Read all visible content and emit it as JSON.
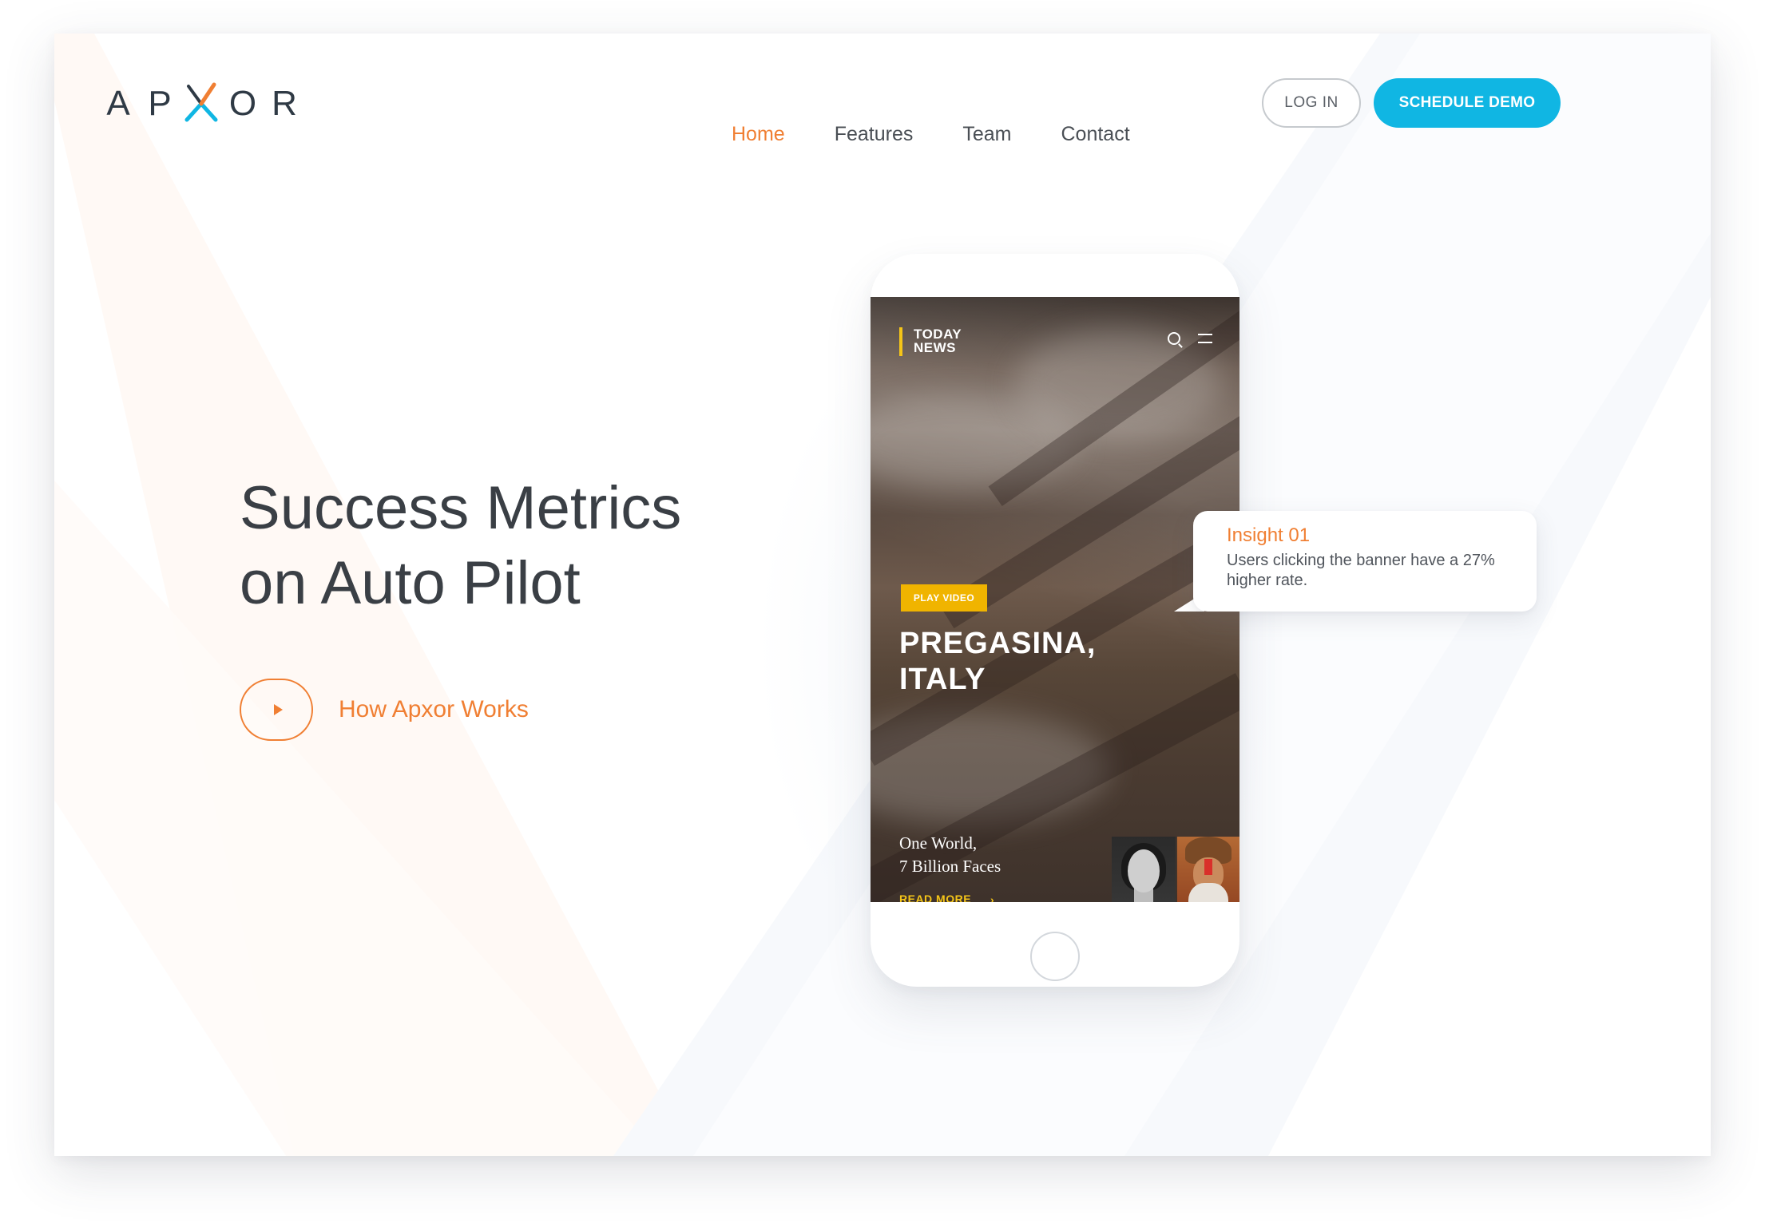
{
  "brand": {
    "logo_letters": [
      "A",
      "P",
      "O",
      "R"
    ],
    "logo_mark_icon": "x-mark-icon",
    "logo_alt": "APXOR",
    "accent_orange": "#f07f33",
    "accent_cyan": "#10b6e3"
  },
  "nav": {
    "items": [
      {
        "label": "Home",
        "active": true
      },
      {
        "label": "Features",
        "active": false
      },
      {
        "label": "Team",
        "active": false
      },
      {
        "label": "Contact",
        "active": false
      }
    ],
    "login_label": "LOG IN",
    "demo_label": "SCHEDULE DEMO"
  },
  "hero": {
    "title_line1": "Success Metrics",
    "title_line2": "on Auto Pilot",
    "play_icon": "play-icon",
    "how_link": "How Apxor Works"
  },
  "phone": {
    "app_name_line1": "TODAY",
    "app_name_line2": "NEWS",
    "play_video_label": "PLAY VIDEO",
    "headline_line1": "PREGASINA,",
    "headline_line2": "ITALY",
    "subhead_line1": "One World,",
    "subhead_line2": "7 Billion Faces",
    "read_more_label": "READ MORE",
    "read_more_arrow": "›"
  },
  "insight": {
    "title": "Insight 01",
    "body": "Users clicking the banner have a 27% higher rate."
  }
}
